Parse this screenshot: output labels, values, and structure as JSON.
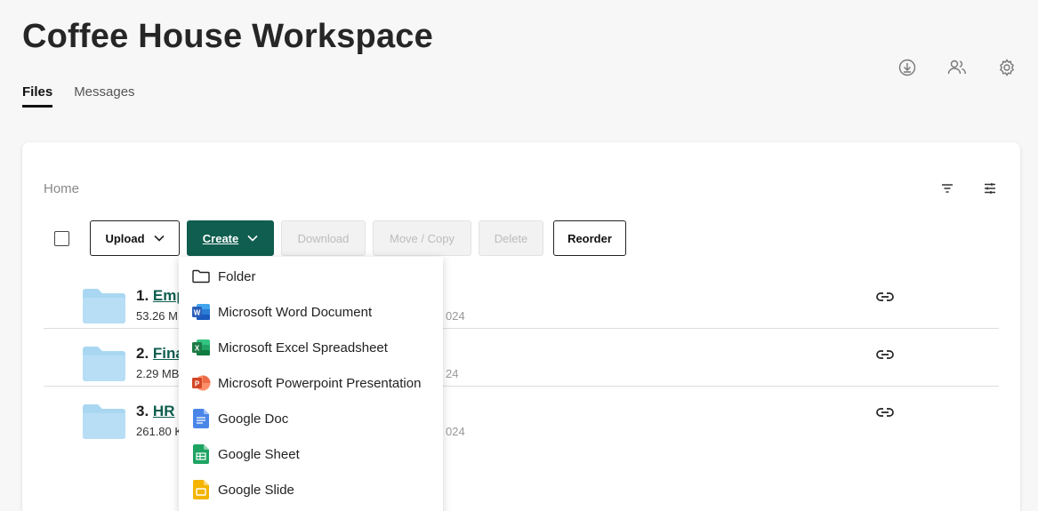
{
  "header": {
    "title": "Coffee House Workspace",
    "tabs": [
      {
        "label": "Files",
        "active": true
      },
      {
        "label": "Messages",
        "active": false
      }
    ],
    "icons": [
      "download-icon",
      "members-icon",
      "settings-icon"
    ]
  },
  "card": {
    "breadcrumb": "Home",
    "tools": [
      "filter-icon",
      "sliders-icon"
    ]
  },
  "toolbar": {
    "upload_label": "Upload",
    "create_label": "Create",
    "download_label": "Download",
    "move_copy_label": "Move / Copy",
    "delete_label": "Delete",
    "reorder_label": "Reorder"
  },
  "rows": [
    {
      "number": "1.",
      "name": "Emp",
      "meta": "53.26 M",
      "date": "024"
    },
    {
      "number": "2.",
      "name": "Fina",
      "meta": "2.29 MB",
      "date": "24"
    },
    {
      "number": "3.",
      "name": "HR ",
      "meta": "261.80 K",
      "date": "024"
    }
  ],
  "create_menu": {
    "items": [
      {
        "label": "Folder",
        "icon": "folder-outline-icon"
      },
      {
        "label": "Microsoft Word Document",
        "icon": "word-icon"
      },
      {
        "label": "Microsoft Excel Spreadsheet",
        "icon": "excel-icon"
      },
      {
        "label": "Microsoft Powerpoint Presentation",
        "icon": "powerpoint-icon"
      },
      {
        "label": "Google Doc",
        "icon": "google-doc-icon"
      },
      {
        "label": "Google Sheet",
        "icon": "google-sheet-icon"
      },
      {
        "label": "Google Slide",
        "icon": "google-slide-icon"
      }
    ]
  },
  "colors": {
    "accent": "#0f5e4f",
    "folder": "#a9d7f2",
    "word": "#2b5fb8",
    "excel": "#1e7a45",
    "powerpoint": "#d24726",
    "gdoc": "#4a86e8",
    "gsheet": "#1ea362",
    "gslide": "#f4b400"
  }
}
